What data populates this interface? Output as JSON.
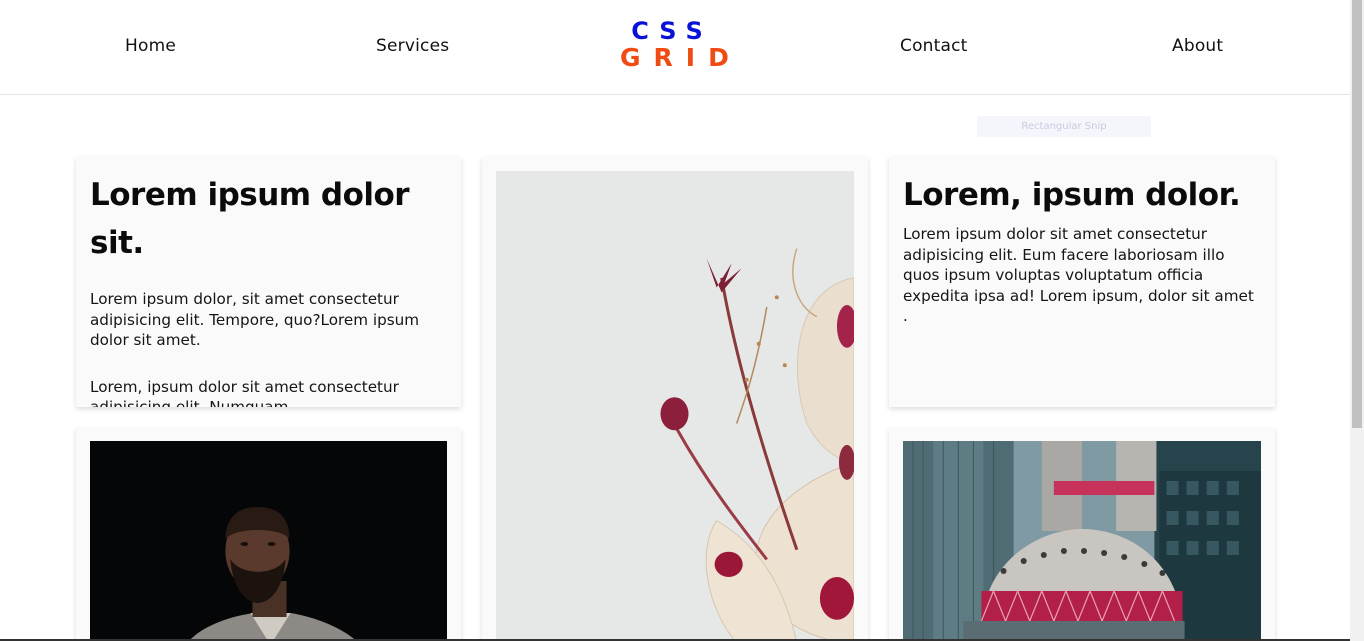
{
  "nav": {
    "items": [
      {
        "label": "Home"
      },
      {
        "label": "Services"
      },
      {
        "label": "Contact"
      },
      {
        "label": "About"
      }
    ],
    "logo_top": "CSS",
    "logo_bottom": "GRID"
  },
  "ghost_label": "Rectangular Snip",
  "cards": {
    "left_text": {
      "title": "Lorem ipsum dolor sit.",
      "paragraph_1": "Lorem ipsum dolor, sit amet consectetur adipisicing elit. Tempore, quo?Lorem ipsum dolor sit amet.",
      "paragraph_2": "Lorem, ipsum dolor sit amet consectetur adipisicing elit. Numquam. ."
    },
    "right_text": {
      "title": "Lorem, ipsum dolor.",
      "paragraph": "Lorem ipsum dolor sit amet consectetur adipisicing elit. Eum facere laboriosam illo quos ipsum voluptas voluptatum officia expedita ipsa ad! Lorem ipsum, dolor sit amet ."
    }
  },
  "colors": {
    "logo_blue": "#0a12d8",
    "logo_orange": "#f04b12"
  }
}
